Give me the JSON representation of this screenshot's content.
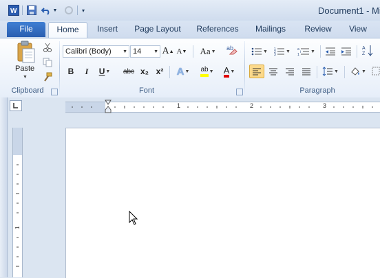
{
  "title_bar": {
    "document_title": "Document1 - Mi",
    "qat_icons": [
      "word-logo-icon",
      "save-icon",
      "undo-icon",
      "redo-icon",
      "customize-icon"
    ]
  },
  "tabs": [
    {
      "label": "File"
    },
    {
      "label": "Home"
    },
    {
      "label": "Insert"
    },
    {
      "label": "Page Layout"
    },
    {
      "label": "References"
    },
    {
      "label": "Mailings"
    },
    {
      "label": "Review"
    },
    {
      "label": "View"
    }
  ],
  "ribbon": {
    "clipboard": {
      "group_label": "Clipboard",
      "paste_label": "Paste"
    },
    "font": {
      "group_label": "Font",
      "font_name": "Calibri (Body)",
      "font_size": "14",
      "bold": "B",
      "italic": "I",
      "underline": "U",
      "strike": "abc",
      "subscript": "x₂",
      "superscript": "x²",
      "change_case": "Aa",
      "text_effects": "A",
      "font_color": "A",
      "grow": "A",
      "shrink": "A",
      "highlight": "ab"
    },
    "paragraph": {
      "group_label": "Paragraph"
    }
  },
  "ruler": {
    "marks": [
      "1",
      "2",
      "3"
    ]
  },
  "colors": {
    "accent": "#2a5eb0",
    "highlight_yellow": "#ffff00",
    "font_color_red": "#e00000",
    "active_align": "#fcd98a"
  }
}
